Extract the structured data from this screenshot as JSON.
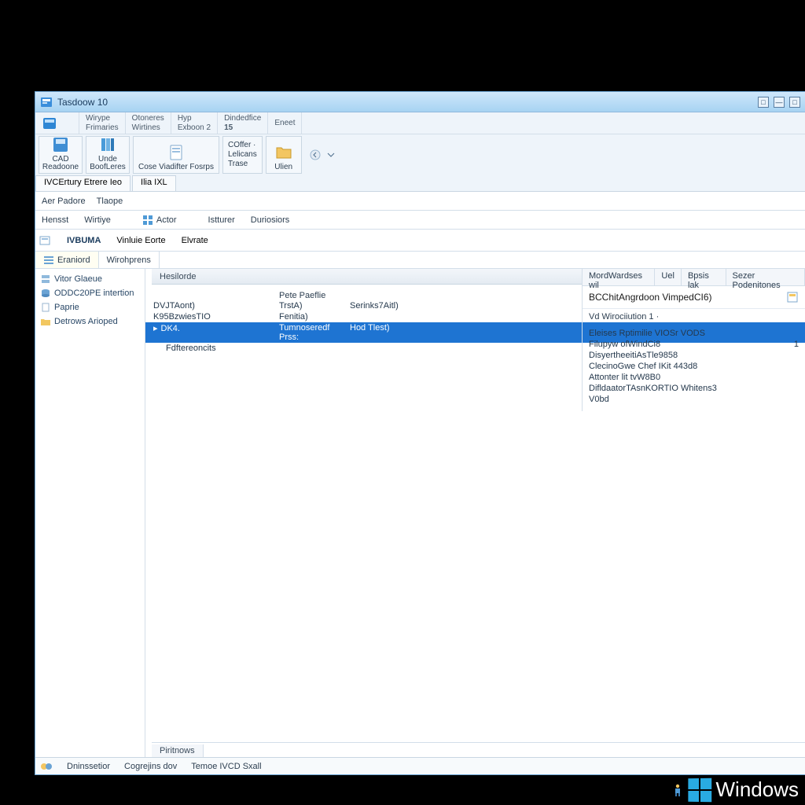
{
  "titlebar": {
    "title": "Tasdoow 10"
  },
  "ribbon": {
    "row1": [
      {
        "top": "Wirype",
        "bottom": "Frimaries"
      },
      {
        "top": "Otoneres",
        "bottom": "Wirtines"
      },
      {
        "top": "Hyp",
        "bottom": "Exboon 2"
      },
      {
        "top": "Dindedfice",
        "bottom": "15"
      },
      {
        "top": "Eneet",
        "bottom": ""
      }
    ],
    "left_big": {
      "label_top": "CAD",
      "label_bottom": "Readoone"
    },
    "big2": {
      "label_top": "Unde",
      "label_bottom": "BoofLeres"
    },
    "big3": {
      "label": "Cose Viadifter Fosrps"
    },
    "grp": {
      "line1": "COffer ·",
      "line2": "Lelicans",
      "line3": "Trase"
    },
    "big4": {
      "label": "Ulien"
    },
    "bottom_tabs": [
      "IVCErtury Etrere Ieo",
      "Ilia IXL"
    ]
  },
  "cmdbar": {
    "items": [
      "Aer  Padore",
      "Tlaope"
    ]
  },
  "cmdbar2": {
    "items": [
      "Hensst",
      "Wirtiye",
      "Actor",
      "Istturer",
      "Duriosiors"
    ]
  },
  "locbar": {
    "label": "IVBUMA",
    "sub1": "Vinluie Eorte",
    "sub2": "Elvrate"
  },
  "toggle_tabs": {
    "a": "Eraniord",
    "b": "Wirohprens"
  },
  "nav": {
    "items": [
      "Vitor Glaeue",
      "ODDC20PE intertion",
      "Paprie",
      "Detrows Arioped"
    ]
  },
  "grid": {
    "header": "Hesilorde",
    "col_headers": {
      "c1": "",
      "c2": "Pete Paeflie",
      "c3": ""
    },
    "rows": [
      {
        "c1": "DVJTAont)",
        "c2": "TrstA)",
        "c3": "Serinks7Aitl)"
      },
      {
        "c1": "K95BzwiesTIO",
        "c2": "Fenitia)",
        "c3": ""
      },
      {
        "c1": "DK4.",
        "c2": "Tumnoseredf Prss:",
        "c3": "Hod Tlest)",
        "selected": true
      },
      {
        "c1": "Fdftereoncits",
        "c2": "",
        "c3": ""
      }
    ]
  },
  "details": {
    "tabs": [
      "MordWardses wil",
      "Uel",
      "Bpsis lak",
      "Sezer Podenitones"
    ],
    "title": "BCChitAngrdoon VimpedCI6)",
    "subtitle": "Vd Wirociiution  1 ·",
    "lines": [
      {
        "l": "Eleises Rptimilie VIOSr VODS",
        "r": ""
      },
      {
        "l": "Filupyw ofWindCi8",
        "r": "1"
      },
      {
        "l": "DisyertheeitiAsTle9858",
        "r": ""
      },
      {
        "l": "ClecinoGwe Chef IKit 443d8",
        "r": ""
      },
      {
        "l": "Attonter lit tvW8B0",
        "r": ""
      },
      {
        "l": "DifldaatorTAsnKORTIO Whitens3",
        "r": ""
      },
      {
        "l": "V0bd",
        "r": ""
      }
    ]
  },
  "inner_bottom_tab": "Piritnows",
  "statusbar": {
    "items": [
      "Dninssetior",
      "Cogrejins dov",
      "Temoe IVCD Sxall"
    ]
  },
  "watermark": "Windows"
}
